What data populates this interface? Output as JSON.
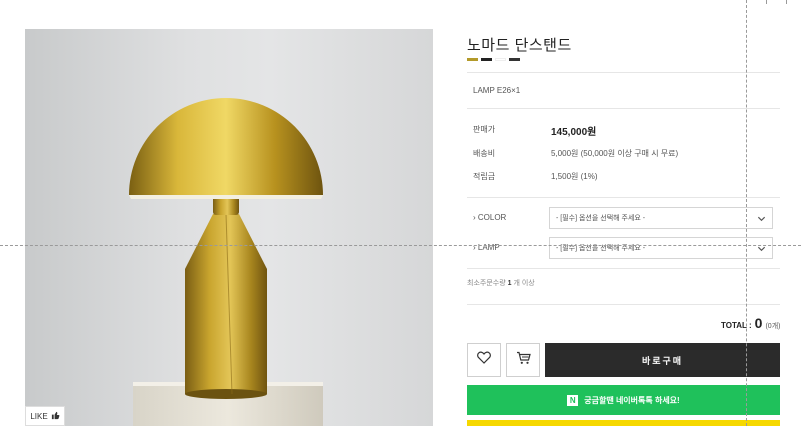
{
  "product": {
    "title": "노마드 단스탠드",
    "swatch_colors": [
      "#b39a2a",
      "#222222",
      "#ffffff",
      "#333333"
    ],
    "lamp_spec": "LAMP E26×1"
  },
  "details": {
    "price_label": "판매가",
    "price_value": "145,000원",
    "shipping_label": "배송비",
    "shipping_value": "5,000원 (50,000원 이상 구매 시 무료)",
    "points_label": "적립금",
    "points_value": "1,500원 (1%)"
  },
  "options": {
    "color_label": "› COLOR",
    "color_placeholder": "- [필수] 옵션을 선택해 주세요 -",
    "lamp_label": "› LAMP",
    "lamp_placeholder": "- [필수] 옵션을 선택해 주세요 -"
  },
  "min_order": {
    "prefix": "최소주문수량",
    "count": "1",
    "suffix": "개 이상"
  },
  "total": {
    "label": "TOTAL :",
    "amount": "0",
    "count": "(0개)"
  },
  "buttons": {
    "buy_now": "바로구매",
    "naver_talk": "궁금할땐 네이버톡톡 하세요!",
    "naver_logo": "N",
    "like": "LIKE"
  }
}
